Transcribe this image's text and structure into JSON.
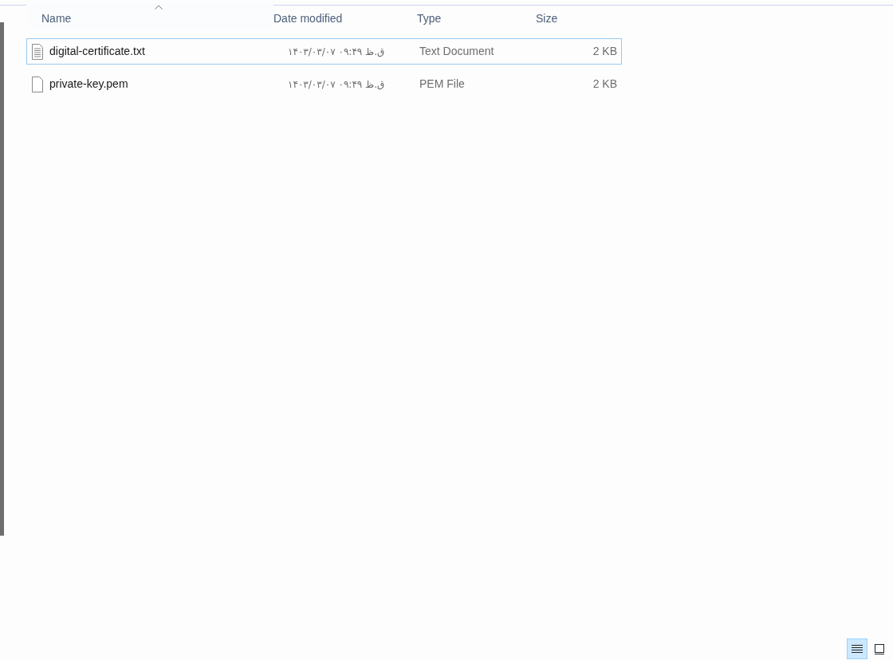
{
  "columns": [
    {
      "label": "Name",
      "sorted": true
    },
    {
      "label": "Date modified",
      "sorted": false
    },
    {
      "label": "Type",
      "sorted": false
    },
    {
      "label": "Size",
      "sorted": false
    }
  ],
  "rows": [
    {
      "kind": "text",
      "name": "digital-certificate.txt",
      "date": "۱۴۰۳/۰۳/۰۷ ق.ظ ۰۹:۴۹",
      "type": "Text Document",
      "size": "2 KB",
      "focused": true
    },
    {
      "kind": "file",
      "name": "private-key.pem",
      "date": "۱۴۰۳/۰۳/۰۷ ق.ظ ۰۹:۴۹",
      "type": "PEM File",
      "size": "2 KB",
      "focused": false
    }
  ],
  "view_buttons": [
    {
      "kind": "details",
      "selected": true
    },
    {
      "kind": "large-icons",
      "selected": false
    }
  ]
}
